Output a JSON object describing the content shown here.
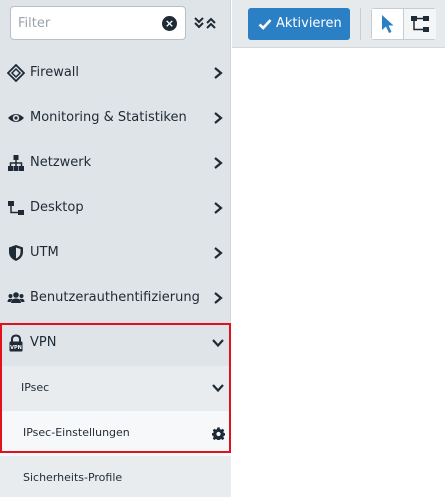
{
  "filter": {
    "placeholder": "Filter"
  },
  "toolbar": {
    "activate_label": "Aktivieren"
  },
  "menu": [
    {
      "label": "Firewall",
      "icon": "firewall-icon"
    },
    {
      "label": "Monitoring & Statistiken",
      "icon": "eye-icon"
    },
    {
      "label": "Netzwerk",
      "icon": "network-icon"
    },
    {
      "label": "Desktop",
      "icon": "desktop-icon"
    },
    {
      "label": "UTM",
      "icon": "shield-icon"
    },
    {
      "label": "Benutzerauthentifizierung",
      "icon": "users-icon"
    },
    {
      "label": "VPN",
      "icon": "vpn-lock-icon",
      "expanded": true
    }
  ],
  "vpn_submenu": {
    "ipsec": {
      "label": "IPsec",
      "expanded": true
    },
    "ipsec_settings": {
      "label": "IPsec-Einstellungen",
      "icon": "gear-icon"
    },
    "security_profiles": {
      "label": "Sicherheits-Profile"
    }
  },
  "colors": {
    "sidebar_bg": "#dfe4e8",
    "expanded_bg": "#e9ecef",
    "selected_bg": "#f7f8f9",
    "accent": "#2a7fc5",
    "highlight_border": "#e3101e"
  }
}
